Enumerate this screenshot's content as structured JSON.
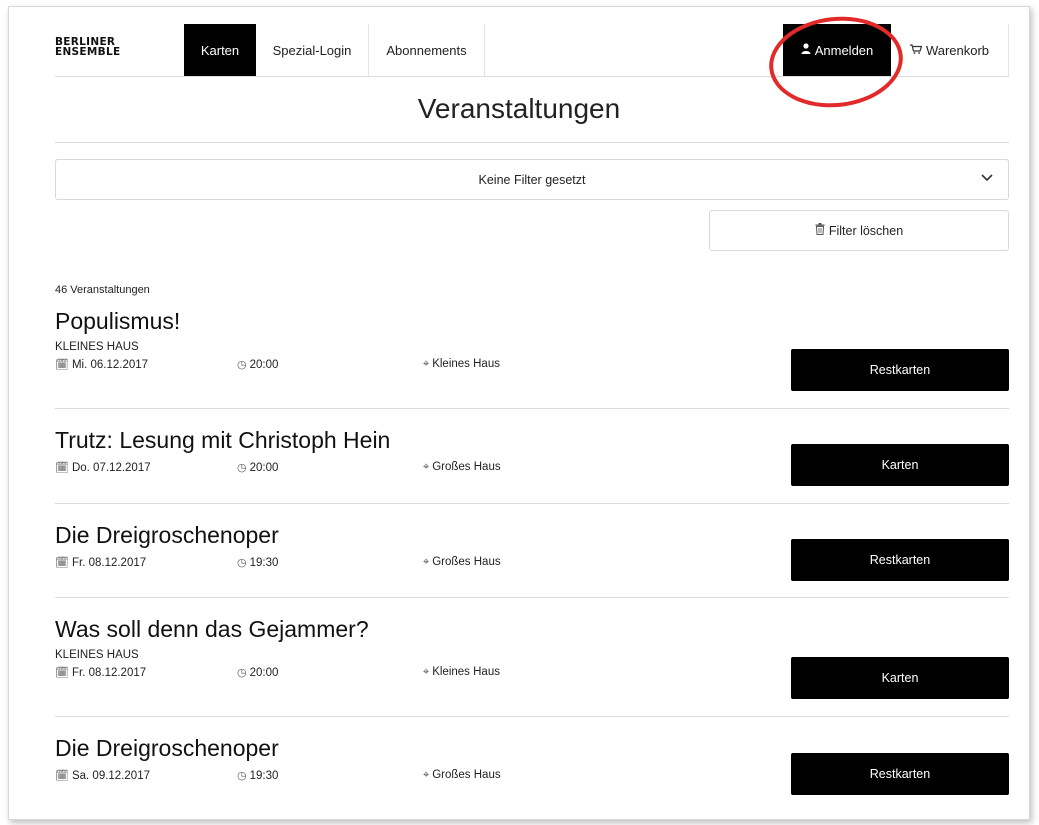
{
  "logo": {
    "line1": "BERLINER",
    "line2": "ENSEMBLE"
  },
  "nav": {
    "left": [
      {
        "label": "Karten",
        "active": true
      },
      {
        "label": "Spezial-Login",
        "active": false
      },
      {
        "label": "Abonnements",
        "active": false
      }
    ],
    "login": {
      "label": "Anmelden",
      "icon": "user-icon"
    },
    "cart": {
      "label": "Warenkorb",
      "icon": "cart-icon"
    }
  },
  "page_title": "Veranstaltungen",
  "filter": {
    "select_label": "Keine Filter gesetzt",
    "clear_label": "Filter löschen"
  },
  "count_label": "46 Veranstaltungen",
  "events": [
    {
      "title": "Populismus!",
      "subtitle": "KLEINES HAUS",
      "date": "Mi. 06.12.2017",
      "time": "20:00",
      "venue": "Kleines Haus",
      "button": "Restkarten"
    },
    {
      "title": "Trutz: Lesung mit Christoph Hein",
      "subtitle": "",
      "date": "Do. 07.12.2017",
      "time": "20:00",
      "venue": "Großes Haus",
      "button": "Karten"
    },
    {
      "title": "Die Dreigroschenoper",
      "subtitle": "",
      "date": "Fr. 08.12.2017",
      "time": "19:30",
      "venue": "Großes Haus",
      "button": "Restkarten"
    },
    {
      "title": "Was soll denn das Gejammer?",
      "subtitle": "KLEINES HAUS",
      "date": "Fr. 08.12.2017",
      "time": "20:00",
      "venue": "Kleines Haus",
      "button": "Karten"
    },
    {
      "title": "Die Dreigroschenoper",
      "subtitle": "",
      "date": "Sa. 09.12.2017",
      "time": "19:30",
      "venue": "Großes Haus",
      "button": "Restkarten"
    }
  ],
  "colors": {
    "accent": "#000000",
    "annotation": "#e32a2a"
  }
}
